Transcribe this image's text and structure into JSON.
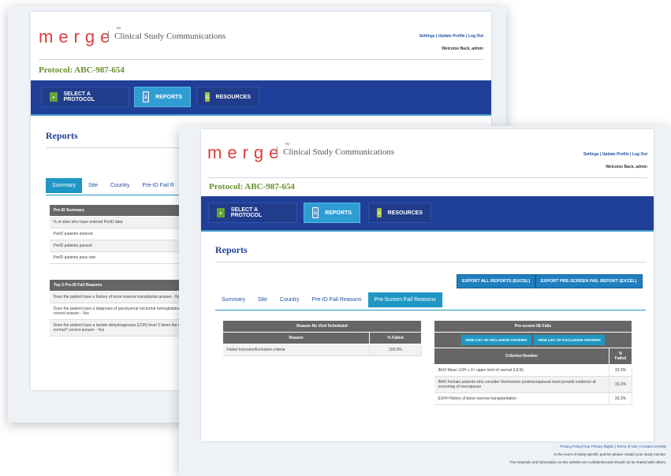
{
  "brand": {
    "logo": "merge",
    "tm": "™",
    "tagline": "Clinical Study Communications"
  },
  "header": {
    "links": [
      "Settings",
      "Update Profile",
      "Log Out"
    ],
    "welcome": "Welcome Back, admin"
  },
  "protocol": "Protocol: ABC-987-654",
  "nav": {
    "select_protocol": "SELECT A PROTOCOL",
    "reports": "REPORTS",
    "resources": "RESOURCES"
  },
  "page_title": "Reports",
  "back_window": {
    "tabs": [
      "Summary",
      "Site",
      "Country",
      "Pre-ID Fail R"
    ],
    "preid_summary": {
      "header": "Pre-ID Summary",
      "rows": [
        "% of sites who have entered PreID data",
        "PreID patients entered",
        "PreID patients passed",
        "PreID patients pass rate"
      ]
    },
    "top3": {
      "header": "Top 3 Pre-ID Fail Reasons",
      "rows": [
        "Does the patient have a history of bone marrow transplantat answer - No",
        "Does the patient have a diagnosis of paroxysmal nocturnal hemoglobinuria (PNH)? correct answer - Yes",
        "Does the patient have a lactate dehydrogenase (LDH) level 3 times the upper limit of normal? correct answer - Yes"
      ]
    }
  },
  "front_window": {
    "export_all": "EXPORT ALL REPORTS (EXCEL)",
    "export_prescreen": "EXPORT PRE-SCREEN FAIL REPORT (EXCEL)",
    "tabs": [
      "Summary",
      "Site",
      "Country",
      "Pre-ID Fail Reasons",
      "Pre-Screen Fail Reasons"
    ],
    "no_visit": {
      "title": "Reason No Visit Scheduled",
      "col_reason": "Reason",
      "col_failed": "% Failed",
      "rows": [
        {
          "reason": "Failed Inclusion/Exclusion criteria",
          "pct": "100.0%"
        }
      ]
    },
    "ie_fails": {
      "title": "Pre-screen I/E Fails",
      "btn_inclusion": "VIEW LIST OF INCLUSION CRITERIA",
      "btn_exclusion": "VIEW LIST OF EXCLUSION CRITERIA",
      "col_criterion": "Criterion Number",
      "col_failed": "% Failed",
      "rows": [
        {
          "criterion": "IN#3 Mean LDH ≥ 2× upper limit of normal (ULN)",
          "pct": "33.3%"
        },
        {
          "criterion": "IN#6 Female patients who consider themselves postmenopausal must provide evidence at screening of menopause",
          "pct": "33.3%"
        },
        {
          "criterion": "EX#4 History of bone marrow transplantation",
          "pct": "33.3%"
        }
      ]
    },
    "footer": {
      "links": [
        "Privacy Policy/Your Privacy Rights",
        "Terms of Use",
        "Contact Us/Help"
      ],
      "line1": "In the event of study-specific queries please contact your study monitor.",
      "line2": "The materials and information on this website are confidential and should not be shared with others."
    }
  }
}
